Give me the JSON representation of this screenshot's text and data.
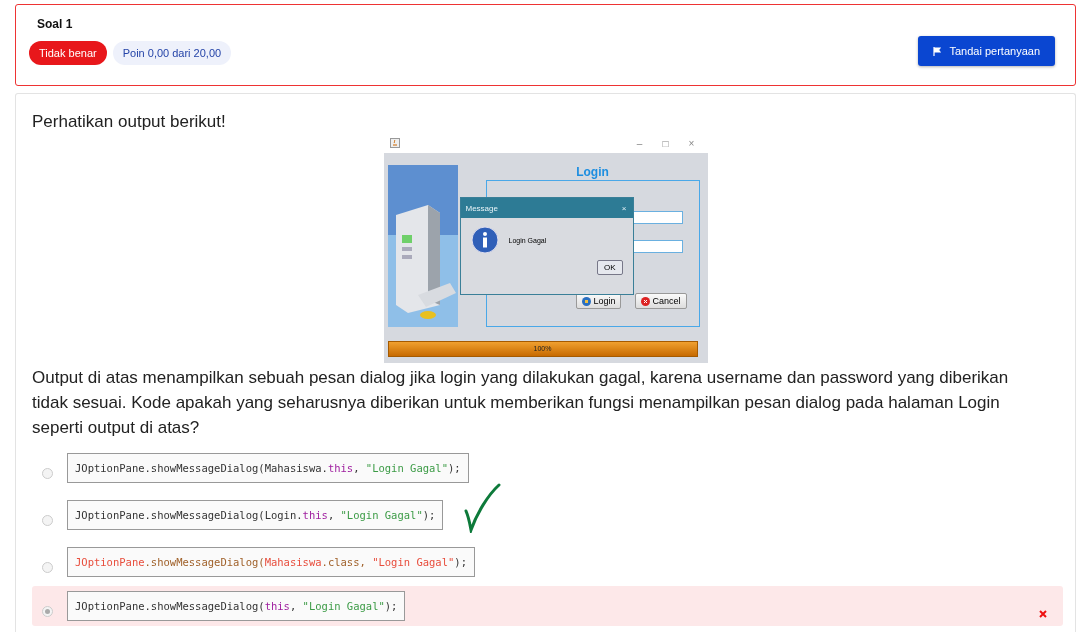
{
  "header": {
    "title": "Soal 1",
    "status": "Tidak benar",
    "points": "Poin 0,00 dari 20,00",
    "flag_button": "Tandai pertanyaan"
  },
  "question": {
    "intro": "Perhatikan output berikut!",
    "app_window": {
      "minimize": "–",
      "maximize": "□",
      "close": "×",
      "heading": "Login",
      "login_button": "Login",
      "cancel_button": "Cancel",
      "progress_label": "100%",
      "level": 1,
      "dialog": {
        "title": "Message",
        "close": "×",
        "message": "Login Gagal",
        "ok_button": "OK"
      }
    },
    "text": "Output di atas menampilkan sebuah pesan dialog jika login yang dilakukan gagal, karena username dan password yang diberikan tidak sesuai. Kode apakah yang seharusnya diberikan untuk memberikan fungsi menampilkan pesan dialog pada halaman Login seperti output di atas?",
    "options": [
      {
        "selected": false,
        "marked_wrong": false,
        "hand_check": false,
        "tokens": [
          {
            "kind": "plain",
            "text": "JOptionPane.showMessageDialog(Mahasiswa."
          },
          {
            "kind": "keyword",
            "text": "this"
          },
          {
            "kind": "plain",
            "text": ", "
          },
          {
            "kind": "string",
            "text": "\"Login Gagal\""
          },
          {
            "kind": "plain",
            "text": ");"
          }
        ]
      },
      {
        "selected": false,
        "marked_wrong": false,
        "hand_check": true,
        "tokens": [
          {
            "kind": "plain",
            "text": "JOptionPane.showMessageDialog(Login."
          },
          {
            "kind": "keyword",
            "text": "this"
          },
          {
            "kind": "plain",
            "text": ", "
          },
          {
            "kind": "string",
            "text": "\"Login Gagal\""
          },
          {
            "kind": "plain",
            "text": ");"
          }
        ]
      },
      {
        "selected": false,
        "marked_wrong": false,
        "hand_check": false,
        "tokens": [
          {
            "kind": "error",
            "text": "JOptionPane"
          },
          {
            "kind": "muted",
            "text": ".showMessageDialog("
          },
          {
            "kind": "error",
            "text": "Mahasiswa"
          },
          {
            "kind": "muted",
            "text": ".class, "
          },
          {
            "kind": "error",
            "text": "\"Login Gagal\""
          },
          {
            "kind": "plain",
            "text": ");"
          }
        ]
      },
      {
        "selected": true,
        "marked_wrong": true,
        "hand_check": false,
        "tokens": [
          {
            "kind": "plain",
            "text": "JOptionPane.showMessageDialog("
          },
          {
            "kind": "keyword",
            "text": "this"
          },
          {
            "kind": "plain",
            "text": ", "
          },
          {
            "kind": "string",
            "text": "\"Login Gagal\""
          },
          {
            "kind": "plain",
            "text": ");"
          }
        ]
      }
    ]
  }
}
